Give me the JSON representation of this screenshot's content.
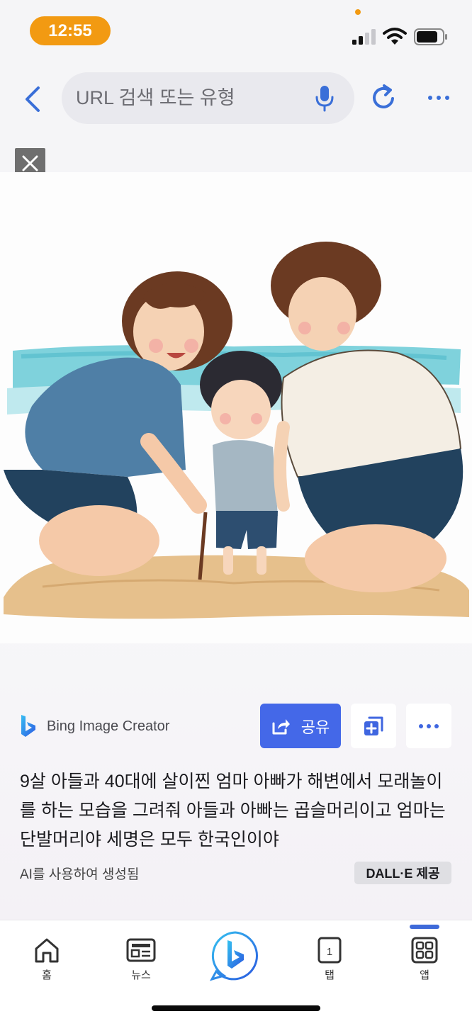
{
  "status_bar": {
    "time": "12:55"
  },
  "address_bar": {
    "placeholder": "URL 검색 또는 유형"
  },
  "card": {
    "brand": "Bing Image Creator",
    "share_label": "공유",
    "prompt": "9살 아들과 40대에 살이찐 엄마 아빠가 해변에서 모래놀이를 하는 모습을 그려줘 아들과 아빠는 곱슬머리이고 엄마는 단발머리야 세명은 모두 한국인이야",
    "ai_note": "AI를 사용하여 생성됨",
    "badge": "DALL·E 제공"
  },
  "tabs": [
    {
      "label": "홈",
      "icon": "home-icon"
    },
    {
      "label": "뉴스",
      "icon": "news-icon"
    },
    {
      "label": "",
      "icon": "bing-chat-icon"
    },
    {
      "label": "탭",
      "icon": "tabs-icon",
      "count": "1"
    },
    {
      "label": "앱",
      "icon": "apps-icon"
    }
  ],
  "colors": {
    "accent": "#4468e8",
    "time_pill": "#f29a12",
    "tab_active": "#3e6ad9"
  }
}
